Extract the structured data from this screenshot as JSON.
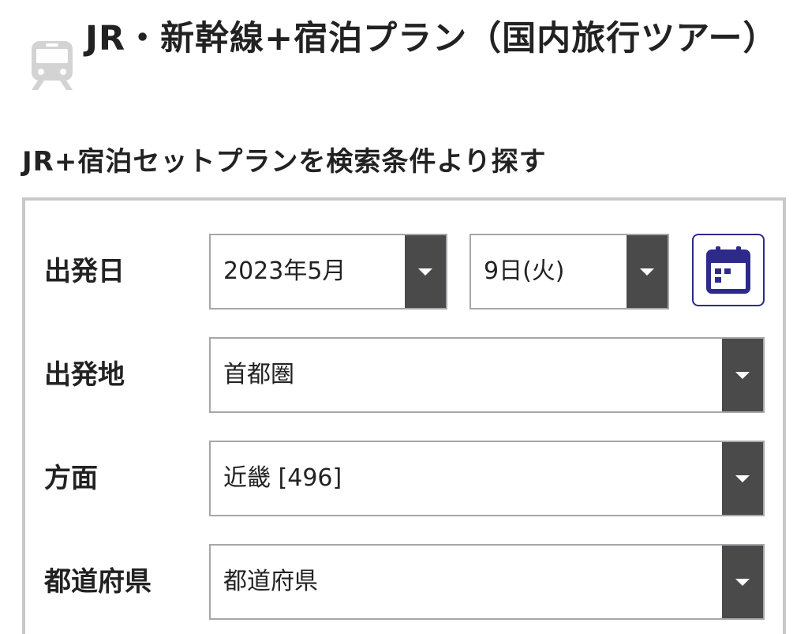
{
  "header": {
    "title": "JR・新幹線+宿泊プラン（国内旅行ツアー）",
    "icon": "train-icon"
  },
  "search": {
    "section_title": "JR+宿泊セットプランを検索条件より探す",
    "departure_date": {
      "label": "出発日",
      "month_value": "2023年5月",
      "day_value": "9日(火)",
      "calendar_icon": "calendar-icon"
    },
    "departure_place": {
      "label": "出発地",
      "value": "首都圏"
    },
    "direction": {
      "label": "方面",
      "value": "近畿 [496]"
    },
    "prefecture": {
      "label": "都道府県",
      "value": "都道府県"
    }
  },
  "colors": {
    "accent": "#2e2a8c",
    "arrow_bg": "#4a4a4a",
    "box_border": "#c8c8c8",
    "icon_gray": "#d0d0d0"
  }
}
